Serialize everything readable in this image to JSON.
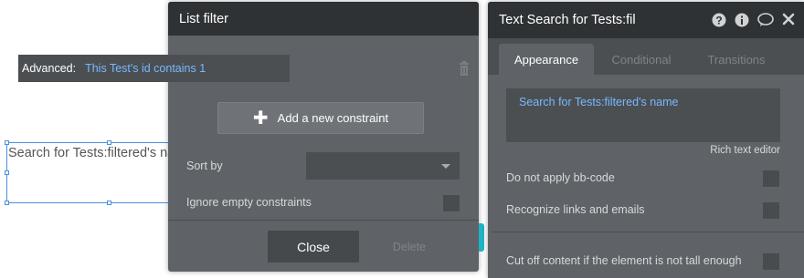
{
  "canvas": {
    "element_text": "Search for Tests:filtered's name"
  },
  "list_filter": {
    "title": "List filter",
    "constraint_type": "Advanced:",
    "constraint_expression": "This Test's id contains 1",
    "add_constraint_label": "Add a new constraint",
    "sort_by_label": "Sort by",
    "sort_by_value": "",
    "ignore_empty_label": "Ignore empty constraints",
    "close_label": "Close",
    "delete_label": "Delete"
  },
  "property_panel": {
    "title": "Text Search for Tests:fil",
    "icons": [
      "help-icon",
      "info-icon",
      "comment-icon",
      "close-icon"
    ],
    "tabs": [
      {
        "label": "Appearance",
        "active": true
      },
      {
        "label": "Conditional",
        "active": false
      },
      {
        "label": "Transitions",
        "active": false
      }
    ],
    "content_expression": "Search for Tests:filtered's name",
    "rich_text_label": "Rich text editor",
    "options": [
      {
        "label": "Do not apply bb-code",
        "checked": false
      },
      {
        "label": "Recognize links and emails",
        "checked": false
      },
      {
        "label": "Cut off content if the element is not tall enough",
        "checked": false
      }
    ]
  },
  "colors": {
    "panel_bg": "#5f6367",
    "header_bg": "#2f3234",
    "expression_blue": "#79b8ff",
    "selection_blue": "#4a90e2",
    "accent_teal": "#20b2c5"
  }
}
